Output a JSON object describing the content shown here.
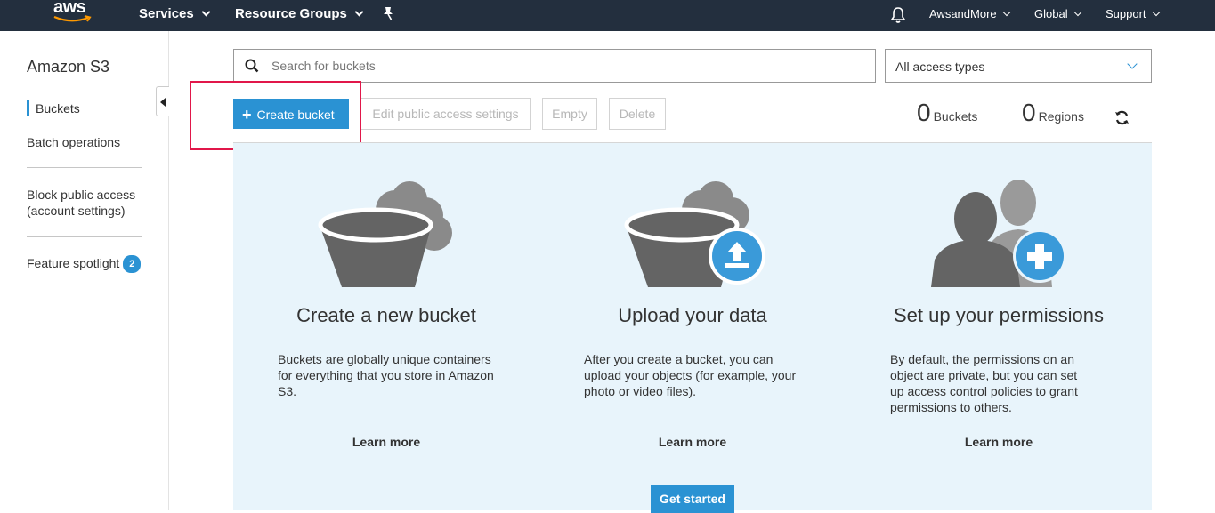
{
  "topnav": {
    "logo": "aws",
    "services": "Services",
    "resource_groups": "Resource Groups",
    "account": "AwsandMore",
    "region": "Global",
    "support": "Support"
  },
  "sidebar": {
    "title": "Amazon S3",
    "items": [
      {
        "label": "Buckets"
      },
      {
        "label": "Batch operations"
      },
      {
        "label": "Block public access (account settings)"
      },
      {
        "label": "Feature spotlight",
        "badge": "2"
      }
    ]
  },
  "search": {
    "placeholder": "Search for buckets"
  },
  "filter": {
    "selected": "All access types"
  },
  "toolbar": {
    "create_bucket": "Create bucket",
    "edit_public_access": "Edit public access settings",
    "empty": "Empty",
    "delete": "Delete"
  },
  "counts": {
    "buckets_num": "0",
    "buckets_label": "Buckets",
    "regions_num": "0",
    "regions_label": "Regions"
  },
  "cards": [
    {
      "title": "Create a new bucket",
      "text": "Buckets are globally unique containers for everything that you store in Amazon S3.",
      "learn": "Learn more"
    },
    {
      "title": "Upload your data",
      "text": "After you create a bucket, you can upload your objects (for example, your photo or video files).",
      "learn": "Learn more"
    },
    {
      "title": "Set up your permissions",
      "text": "By default, the permissions on an object are private, but you can set up access control policies to grant permissions to others.",
      "learn": "Learn more"
    }
  ],
  "get_started": "Get started",
  "colors": {
    "nav_bg": "#232f3e",
    "accent": "#2a92d3",
    "panel_bg": "#e8f4fb",
    "highlight": "#e1174a"
  },
  "icons": [
    "bell-icon",
    "pin-icon",
    "search-icon",
    "refresh-icon",
    "bucket-cloud-icon",
    "upload-icon",
    "users-plus-icon"
  ]
}
